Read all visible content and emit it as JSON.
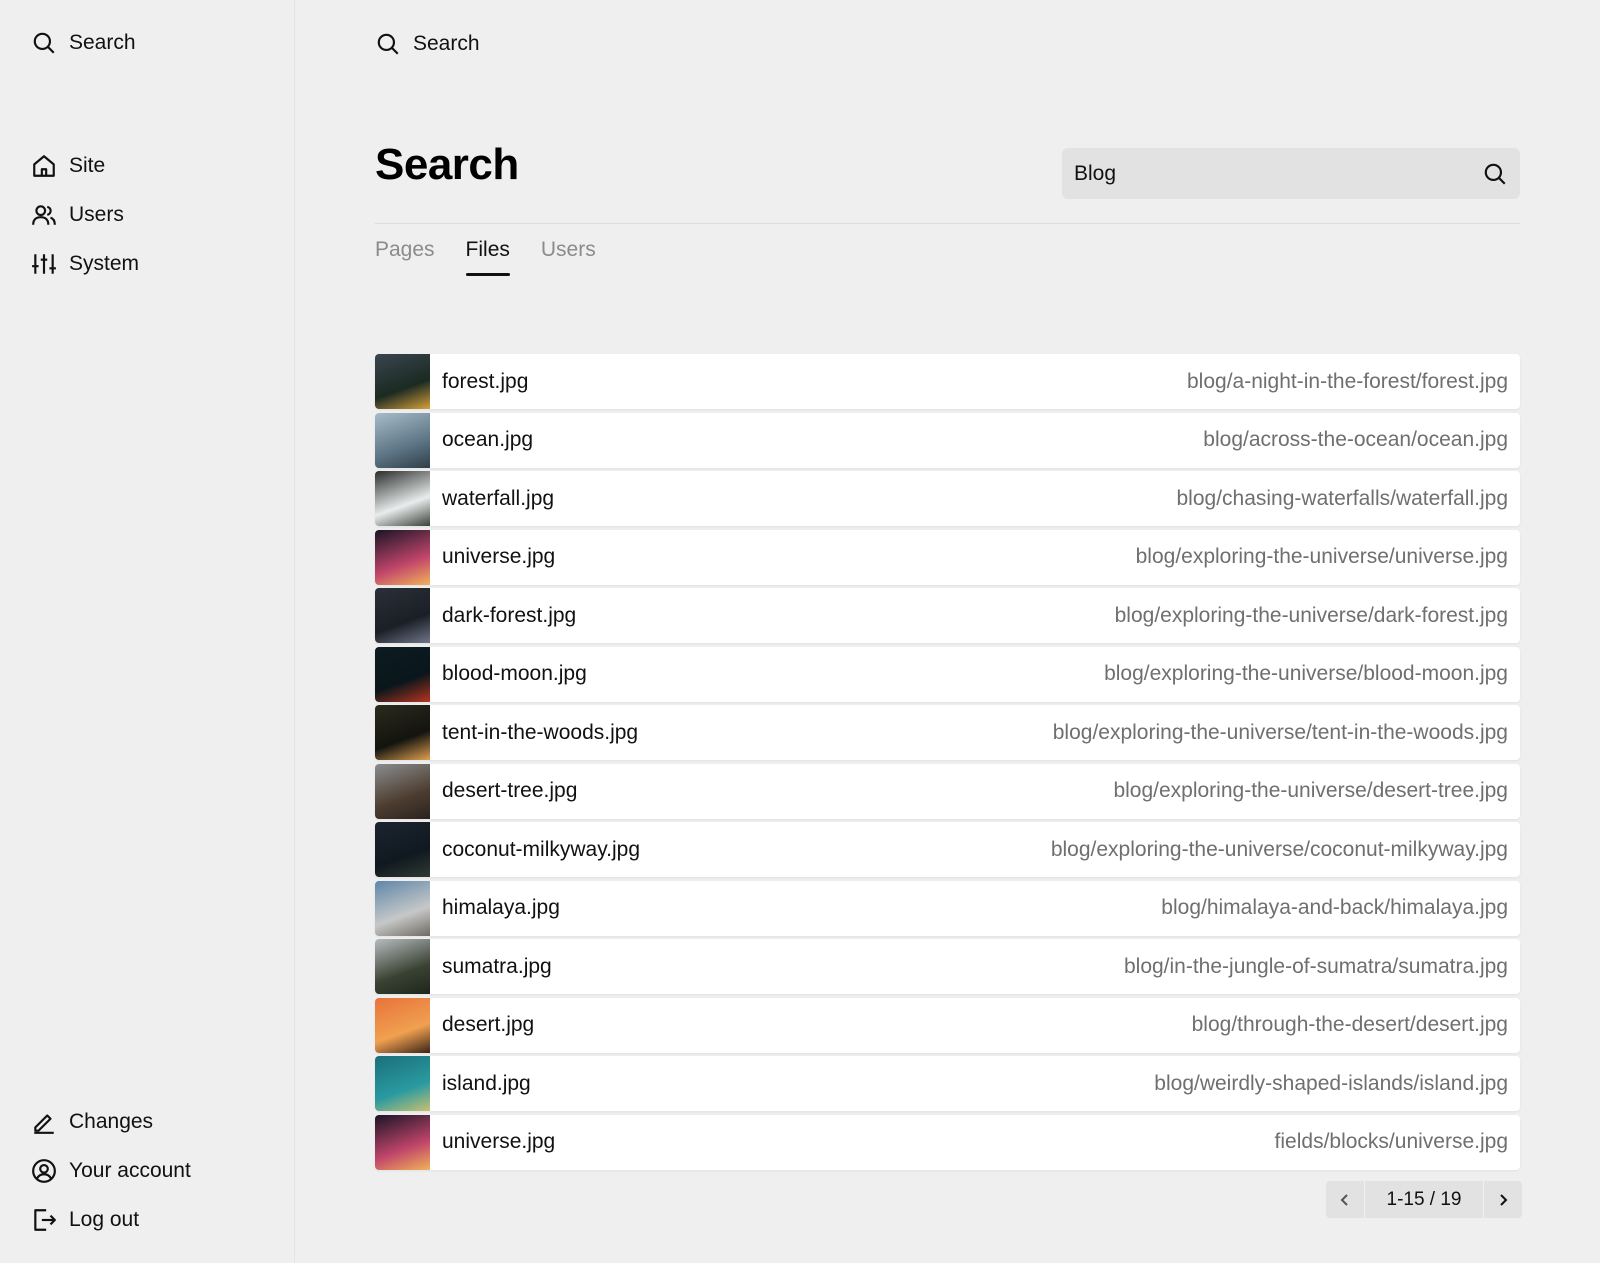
{
  "sidebar": {
    "search_label": "Search",
    "nav": [
      {
        "label": "Site",
        "icon": "home-icon"
      },
      {
        "label": "Users",
        "icon": "users-icon"
      },
      {
        "label": "System",
        "icon": "sliders-icon"
      }
    ],
    "bottom": [
      {
        "label": "Changes",
        "icon": "pen-icon"
      },
      {
        "label": "Your account",
        "icon": "user-circle-icon"
      },
      {
        "label": "Log out",
        "icon": "logout-icon"
      }
    ]
  },
  "header": {
    "search_label": "Search"
  },
  "page": {
    "title": "Search",
    "search_value": "Blog",
    "tabs": [
      {
        "label": "Pages",
        "active": false
      },
      {
        "label": "Files",
        "active": true
      },
      {
        "label": "Users",
        "active": false
      }
    ]
  },
  "results": [
    {
      "name": "forest.jpg",
      "path": "blog/a-night-in-the-forest/forest.jpg",
      "thumb": [
        "#3a4550",
        "#1b2a22",
        "#d6a03a"
      ]
    },
    {
      "name": "ocean.jpg",
      "path": "blog/across-the-ocean/ocean.jpg",
      "thumb": [
        "#a8bcc8",
        "#5d7586",
        "#2f3e48"
      ]
    },
    {
      "name": "waterfall.jpg",
      "path": "blog/chasing-waterfalls/waterfall.jpg",
      "thumb": [
        "#2a2d2a",
        "#e8ecec",
        "#3b3f38"
      ]
    },
    {
      "name": "universe.jpg",
      "path": "blog/exploring-the-universe/universe.jpg",
      "thumb": [
        "#1a1426",
        "#c0456a",
        "#f2b25a"
      ]
    },
    {
      "name": "dark-forest.jpg",
      "path": "blog/exploring-the-universe/dark-forest.jpg",
      "thumb": [
        "#2b3038",
        "#1a1f26",
        "#6f7688"
      ]
    },
    {
      "name": "blood-moon.jpg",
      "path": "blog/exploring-the-universe/blood-moon.jpg",
      "thumb": [
        "#0c1c22",
        "#0a161b",
        "#b8341f"
      ]
    },
    {
      "name": "tent-in-the-woods.jpg",
      "path": "blog/exploring-the-universe/tent-in-the-woods.jpg",
      "thumb": [
        "#2a2a1c",
        "#141410",
        "#e0a050"
      ]
    },
    {
      "name": "desert-tree.jpg",
      "path": "blog/exploring-the-universe/desert-tree.jpg",
      "thumb": [
        "#8b8d8f",
        "#4d3d30",
        "#2a2220"
      ]
    },
    {
      "name": "coconut-milkyway.jpg",
      "path": "blog/exploring-the-universe/coconut-milkyway.jpg",
      "thumb": [
        "#1c2430",
        "#101820",
        "#2f3a30"
      ]
    },
    {
      "name": "himalaya.jpg",
      "path": "blog/himalaya-and-back/himalaya.jpg",
      "thumb": [
        "#5f86a8",
        "#c6c8c8",
        "#6f6a62"
      ]
    },
    {
      "name": "sumatra.jpg",
      "path": "blog/in-the-jungle-of-sumatra/sumatra.jpg",
      "thumb": [
        "#b6bcc0",
        "#394232",
        "#1e261c"
      ]
    },
    {
      "name": "desert.jpg",
      "path": "blog/through-the-desert/desert.jpg",
      "thumb": [
        "#e8733a",
        "#f0a050",
        "#3a2418"
      ]
    },
    {
      "name": "island.jpg",
      "path": "blog/weirdly-shaped-islands/island.jpg",
      "thumb": [
        "#1a6f7a",
        "#2a9aa0",
        "#c8c070"
      ]
    },
    {
      "name": "universe.jpg",
      "path": "fields/blocks/universe.jpg",
      "thumb": [
        "#1a1426",
        "#c0456a",
        "#f2b25a"
      ]
    }
  ],
  "pagination": {
    "label": "1-15 / 19",
    "prev_icon": "chevron-left-icon",
    "next_icon": "chevron-right-icon"
  }
}
